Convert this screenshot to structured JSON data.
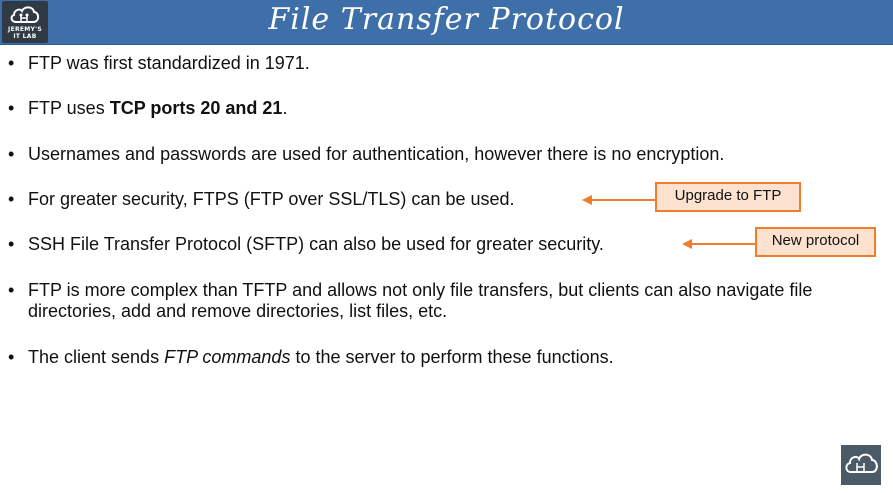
{
  "header": {
    "title": "File Transfer Protocol",
    "logo_line1": "JEREMY'S",
    "logo_line2": "IT LAB"
  },
  "bullets": [
    {
      "parts": [
        {
          "text": "FTP was first standardized in 1971.",
          "style": "normal"
        }
      ]
    },
    {
      "parts": [
        {
          "text": "FTP uses ",
          "style": "normal"
        },
        {
          "text": "TCP ports 20 and 21",
          "style": "bold"
        },
        {
          "text": ".",
          "style": "normal"
        }
      ]
    },
    {
      "parts": [
        {
          "text": "Usernames and passwords are used for authentication, however there is no encryption.",
          "style": "normal"
        }
      ]
    },
    {
      "parts": [
        {
          "text": "For greater security, FTPS (FTP over SSL/TLS) can be used.",
          "style": "normal"
        }
      ]
    },
    {
      "parts": [
        {
          "text": "SSH File Transfer Protocol (SFTP) can also be used for greater security.",
          "style": "normal"
        }
      ]
    },
    {
      "parts": [
        {
          "text": "FTP is more complex than TFTP and allows not only file transfers, but clients can also navigate file directories, add and remove directories, list files, etc.",
          "style": "normal"
        }
      ]
    },
    {
      "parts": [
        {
          "text": "The client sends ",
          "style": "normal"
        },
        {
          "text": "FTP commands",
          "style": "italic"
        },
        {
          "text": " to the server to perform these functions.",
          "style": "normal"
        }
      ]
    }
  ],
  "callouts": [
    {
      "label": "Upgrade to FTP"
    },
    {
      "label": "New protocol"
    }
  ],
  "colors": {
    "header": "#3e6fa8",
    "callout_border": "#f07d2e",
    "callout_fill": "#fde2cf"
  },
  "icons": [
    "cloud-network-icon"
  ]
}
